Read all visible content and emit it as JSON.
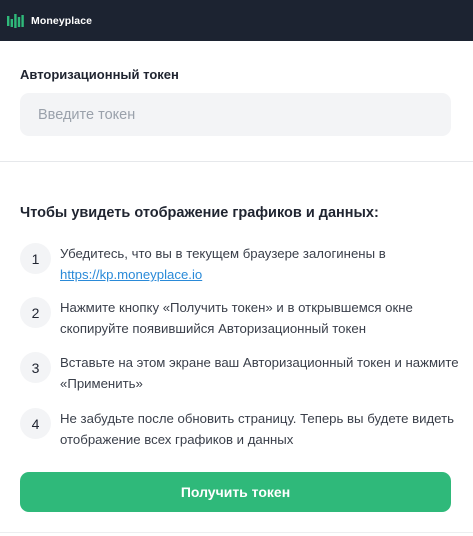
{
  "header": {
    "brand": "Moneyplace",
    "logo_icon": "bar-chart-logo-icon",
    "bg_color": "#1c2331"
  },
  "token": {
    "label": "Авторизационный токен",
    "placeholder": "Введите токен",
    "value": ""
  },
  "instructions": {
    "title": "Чтобы увидеть отображение графиков и данных:",
    "steps": [
      {
        "number": "1",
        "text": "Убедитесь, что вы в текущем браузере залогинены в",
        "link": "https://kp.moneyplace.io"
      },
      {
        "number": "2",
        "text": "Нажмите кнопку «Получить токен» и в открывшемся окне скопируйте появившийся Авторизационный токен"
      },
      {
        "number": "3",
        "text": "Вставьте на этом экране ваш Авторизационный токен и нажмите «Применить»"
      },
      {
        "number": "4",
        "text": "Не забудьте после обновить страницу. Теперь вы будете видеть отображение всех графиков и данных"
      }
    ]
  },
  "actions": {
    "get_token_label": "Получить токен",
    "button_color": "#2fb97a"
  }
}
